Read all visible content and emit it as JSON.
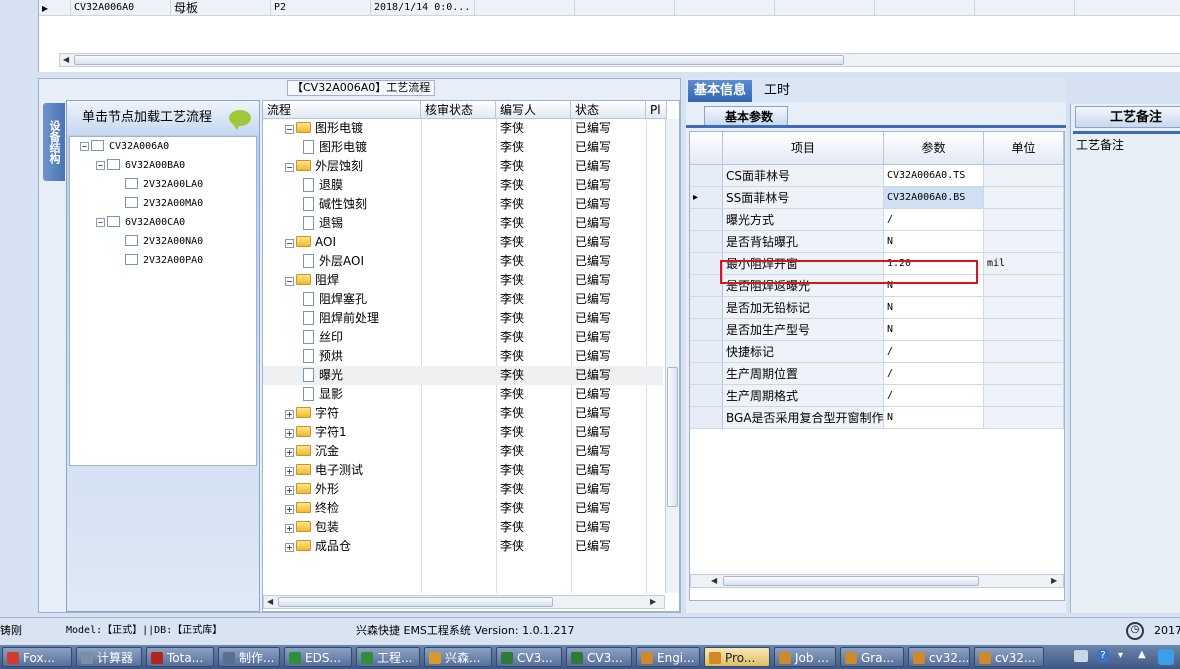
{
  "top_grid": {
    "row": [
      "CV32A006A0",
      "母板",
      "P2",
      "2018/1/14 0:0..."
    ]
  },
  "left": {
    "process_title": "【CV32A006A0】工艺流程",
    "side_tab": "设备结构",
    "tree_header": "单击节点加载工艺流程",
    "tree": [
      {
        "label": "CV32A006A0",
        "pm": "−"
      },
      {
        "label": "6V32A00BA0",
        "pm": "−"
      },
      {
        "label": "2V32A00LA0",
        "pm": ""
      },
      {
        "label": "2V32A00MA0",
        "pm": ""
      },
      {
        "label": "6V32A00CA0",
        "pm": "−"
      },
      {
        "label": "2V32A00NA0",
        "pm": ""
      },
      {
        "label": "2V32A00PA0",
        "pm": ""
      }
    ],
    "columns": [
      "流程",
      "核审状态",
      "编写人",
      "状态",
      "Pl"
    ],
    "rows": [
      {
        "name": "图形电镀",
        "type": "folder",
        "pm": "−",
        "author": "李侠",
        "status": "已编写"
      },
      {
        "name": "图形电镀",
        "type": "page",
        "author": "李侠",
        "status": "已编写"
      },
      {
        "name": "外层蚀刻",
        "type": "folder",
        "pm": "−",
        "author": "李侠",
        "status": "已编写"
      },
      {
        "name": "退膜",
        "type": "page",
        "author": "李侠",
        "status": "已编写"
      },
      {
        "name": "碱性蚀刻",
        "type": "page",
        "author": "李侠",
        "status": "已编写"
      },
      {
        "name": "退锡",
        "type": "page",
        "author": "李侠",
        "status": "已编写"
      },
      {
        "name": "AOI",
        "type": "folder",
        "pm": "−",
        "author": "李侠",
        "status": "已编写"
      },
      {
        "name": "外层AOI",
        "type": "page",
        "author": "李侠",
        "status": "已编写"
      },
      {
        "name": "阻焊",
        "type": "folder",
        "pm": "−",
        "author": "李侠",
        "status": "已编写"
      },
      {
        "name": "阻焊塞孔",
        "type": "page",
        "author": "李侠",
        "status": "已编写"
      },
      {
        "name": "阻焊前处理",
        "type": "page",
        "author": "李侠",
        "status": "已编写"
      },
      {
        "name": "丝印",
        "type": "page",
        "author": "李侠",
        "status": "已编写"
      },
      {
        "name": "预烘",
        "type": "page",
        "author": "李侠",
        "status": "已编写"
      },
      {
        "name": "曝光",
        "type": "page",
        "author": "李侠",
        "status": "已编写",
        "selected": true
      },
      {
        "name": "显影",
        "type": "page",
        "author": "李侠",
        "status": "已编写"
      },
      {
        "name": "字符",
        "type": "folder",
        "pm": "+",
        "author": "李侠",
        "status": "已编写"
      },
      {
        "name": "字符1",
        "type": "folder",
        "pm": "+",
        "author": "李侠",
        "status": "已编写"
      },
      {
        "name": "沉金",
        "type": "folder",
        "pm": "+",
        "author": "李侠",
        "status": "已编写"
      },
      {
        "name": "电子测试",
        "type": "folder",
        "pm": "+",
        "author": "李侠",
        "status": "已编写"
      },
      {
        "name": "外形",
        "type": "folder",
        "pm": "+",
        "author": "李侠",
        "status": "已编写"
      },
      {
        "name": "终检",
        "type": "folder",
        "pm": "+",
        "author": "李侠",
        "status": "已编写"
      },
      {
        "name": "包装",
        "type": "folder",
        "pm": "+",
        "author": "李侠",
        "status": "已编写"
      },
      {
        "name": "成品仓",
        "type": "folder",
        "pm": "+",
        "author": "李侠",
        "status": "已编写"
      }
    ]
  },
  "right": {
    "tabs": [
      "基本信息",
      "工时"
    ],
    "subtab": "基本参数",
    "columns": [
      "项目",
      "参数",
      "单位"
    ],
    "rows": [
      {
        "label": "CS面菲林号",
        "value": "CV32A006A0.TS",
        "unit": ""
      },
      {
        "label": "SS面菲林号",
        "value": "CV32A006A0.BS",
        "unit": "",
        "current": true
      },
      {
        "label": "曝光方式",
        "value": "/",
        "unit": ""
      },
      {
        "label": "是否背钻曝孔",
        "value": "N",
        "unit": ""
      },
      {
        "label": "最小阻焊开窗",
        "value": "1.20",
        "unit": "mil"
      },
      {
        "label": "是否阻焊返曝光",
        "value": "N",
        "unit": ""
      },
      {
        "label": "是否加无铅标记",
        "value": "N",
        "unit": ""
      },
      {
        "label": "是否加生产型号",
        "value": "N",
        "unit": ""
      },
      {
        "label": "快捷标记",
        "value": "/",
        "unit": ""
      },
      {
        "label": "生产周期位置",
        "value": "/",
        "unit": ""
      },
      {
        "label": "生产周期格式",
        "value": "/",
        "unit": ""
      },
      {
        "label": "BGA是否采用复合型开窗制作",
        "value": "N",
        "unit": ""
      }
    ]
  },
  "notes": {
    "title": "工艺备注",
    "label": "工艺备注"
  },
  "status": {
    "left": "铸刚",
    "model": "Model:【正式】||DB:【正式库】",
    "system": "兴森快捷 EMS工程系统 Version: 1.0.1.217",
    "year": "2017"
  },
  "taskbar": [
    {
      "label": "Fox...",
      "color": "#d33b2c"
    },
    {
      "label": "计算器",
      "color": "#7b8ea8"
    },
    {
      "label": "Tota...",
      "color": "#b3261e"
    },
    {
      "label": "制作...",
      "color": "#5a6f8e"
    },
    {
      "label": "EDS...",
      "color": "#2f8f3a"
    },
    {
      "label": "工程...",
      "color": "#2f8f3a"
    },
    {
      "label": "兴森...",
      "color": "#d99a2b"
    },
    {
      "label": "CV3...",
      "color": "#2f7a3a"
    },
    {
      "label": "CV3...",
      "color": "#2f7a3a"
    },
    {
      "label": "Engi...",
      "color": "#cc8a2a"
    },
    {
      "label": "Pro...",
      "color": "#cc8a2a",
      "active": true
    },
    {
      "label": "Job ...",
      "color": "#cc8a2a"
    },
    {
      "label": "Gra...",
      "color": "#cc8a2a"
    },
    {
      "label": "cv32...",
      "color": "#cc8a2a"
    },
    {
      "label": "cv32...",
      "color": "#cc8a2a"
    }
  ]
}
